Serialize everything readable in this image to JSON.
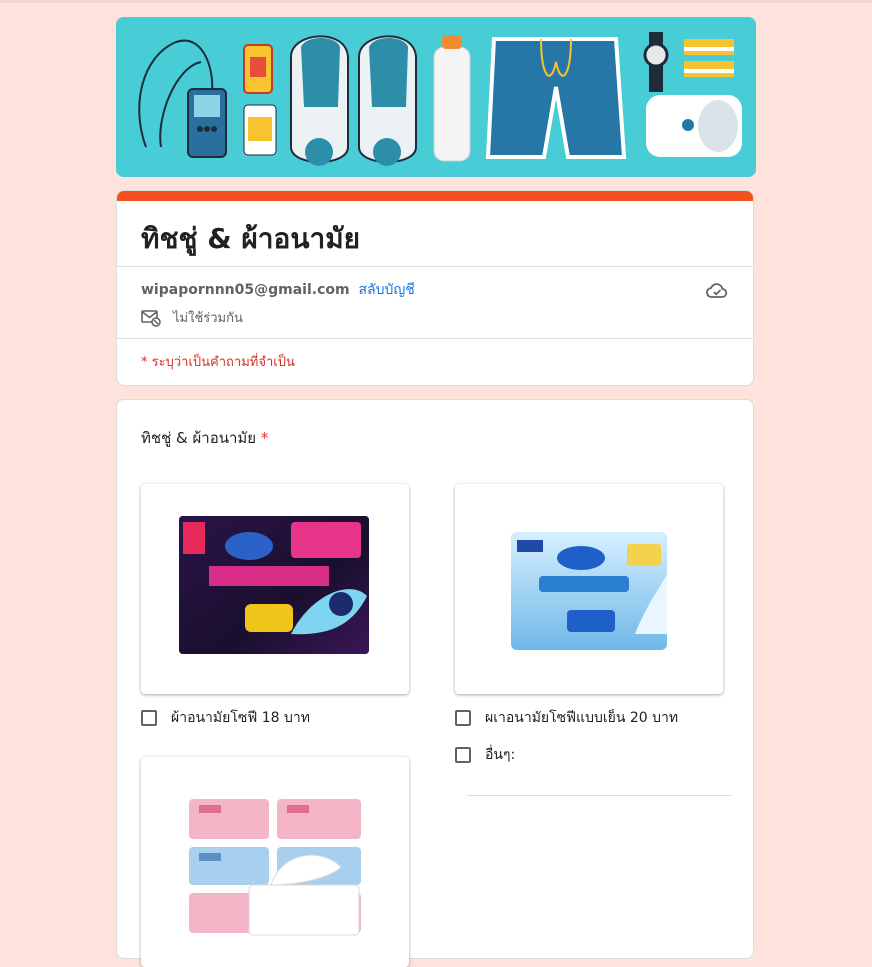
{
  "form": {
    "title": "ทิชชู่ & ผ้าอนามัย",
    "account_email": "wipapornnn05@gmail.com",
    "switch_account": "สลับบัญชี",
    "not_shared": "ไม่ใช้ร่วมกัน",
    "required_note": "* ระบุว่าเป็นคำถามที่จำเป็น"
  },
  "question": {
    "title": "ทิชชู่ & ผ้าอนามัย",
    "required_mark": "*",
    "options": [
      {
        "label": "ผ้าอนามัยโซฟี 18 บาท",
        "checked": false
      },
      {
        "label": "ผเาอนามัยโซฟีแบบเย็น 20 บาท",
        "checked": false
      },
      {
        "label": "อื่นๆ:",
        "checked": false
      }
    ]
  },
  "colors": {
    "page_background": "#fde3dc",
    "accent": "#f4511e",
    "link": "#1a73e8",
    "required": "#d93025",
    "banner": "#3fc8d2"
  },
  "icons": [
    "cloud-icon",
    "mail-off-icon",
    "checkbox"
  ]
}
